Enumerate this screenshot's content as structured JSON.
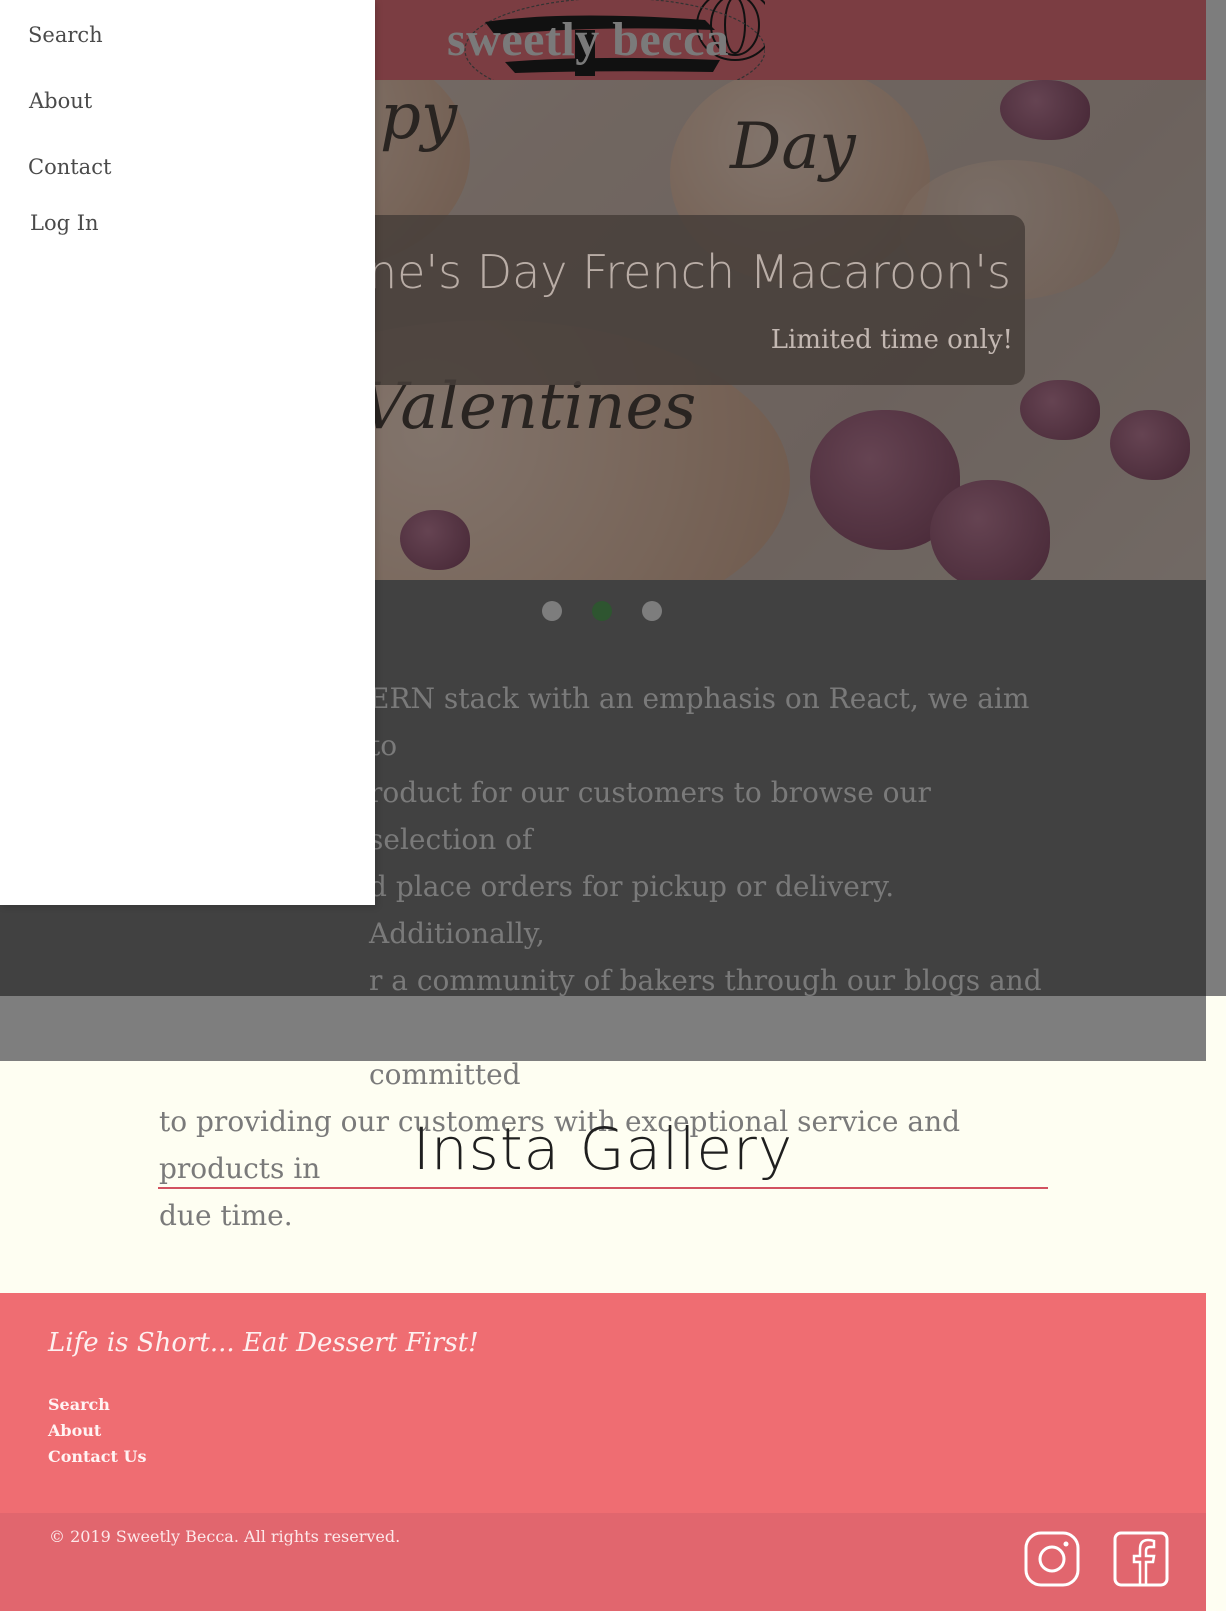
{
  "brand": {
    "name": "sweetly becca"
  },
  "drawer": {
    "items": [
      {
        "label": "Search"
      },
      {
        "label": "About"
      },
      {
        "label": "Contact"
      },
      {
        "label": "Log In"
      }
    ]
  },
  "hero": {
    "caption_title": "ntine's Day French Macaroon's",
    "caption_subtitle": "Limited time only!",
    "carousel": {
      "slide_count": 3,
      "active_index": 1
    }
  },
  "about": {
    "lines": [
      "ERN stack with an emphasis on React, we aim to",
      "roduct for our customers to browse our selection of",
      "d place orders for pickup or delivery. Additionally,",
      "r a community of bakers through our blogs and",
      "nication. turnaround time. We are fully committed",
      "to providing our customers with exceptional service and products in",
      "due time."
    ]
  },
  "gallery": {
    "title": "Insta Gallery"
  },
  "footer": {
    "tagline": "Life is Short... Eat Dessert First!",
    "links": [
      "Search",
      "About",
      "Contact Us"
    ],
    "copyright": "© 2019 Sweetly Becca. All rights reserved.",
    "social": [
      "instagram-icon",
      "facebook-icon"
    ]
  },
  "colors": {
    "navbar": "#7b3d42",
    "footer": "#ef6d72",
    "footer_bottom": "#e1666e",
    "gallery_rule": "#d25260",
    "active_dot": "#2e5530",
    "page_bg": "#fefef2"
  }
}
